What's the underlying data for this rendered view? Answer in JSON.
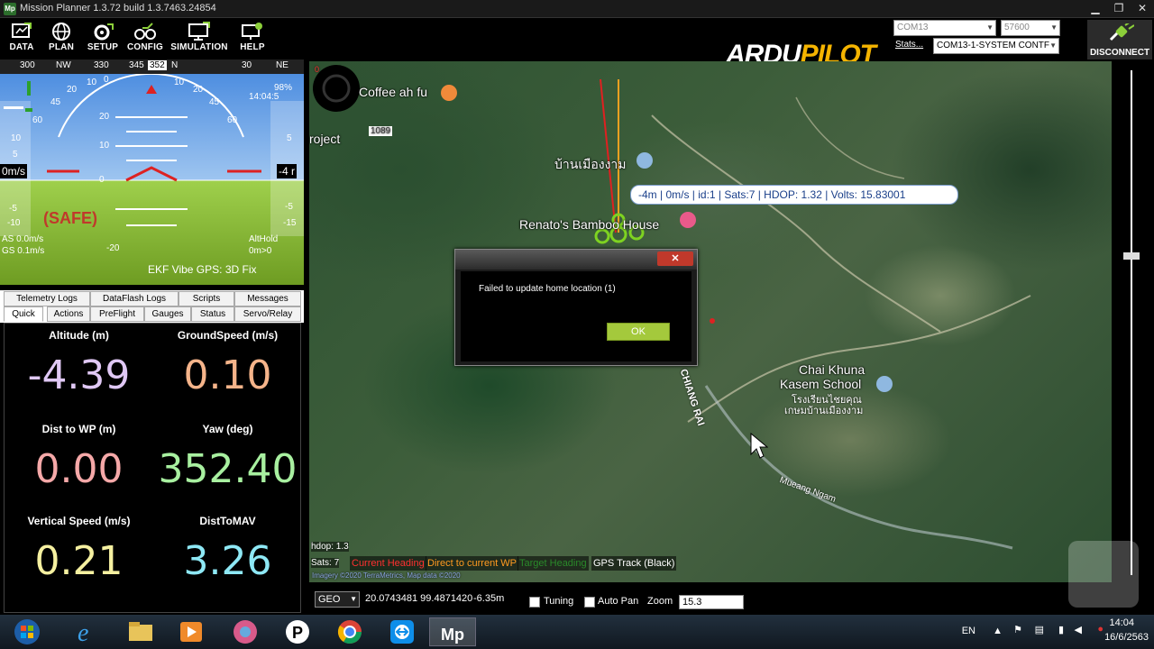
{
  "window": {
    "title": "Mission Planner 1.3.72 build 1.3.7463.24854",
    "app_icon_text": "Mp",
    "minimize": "▁",
    "maximize": "❐",
    "close": "✕"
  },
  "menu": [
    {
      "label": "DATA",
      "icon": "data-icon"
    },
    {
      "label": "PLAN",
      "icon": "plan-globe-icon"
    },
    {
      "label": "SETUP",
      "icon": "setup-icon"
    },
    {
      "label": "CONFIG",
      "icon": "config-icon"
    },
    {
      "label": "SIMULATION",
      "icon": "simulation-icon"
    },
    {
      "label": "HELP",
      "icon": "help-icon"
    }
  ],
  "header": {
    "logo_white": "ARDU",
    "logo_gold": "PILOT",
    "port": "COM13",
    "baud": "57600",
    "stats_link": "Stats...",
    "link_id": "COM13-1-SYSTEM CONTF",
    "disconnect_label": "DISCONNECT"
  },
  "hud": {
    "compass": [
      "300",
      "NW",
      "330",
      "345",
      "352",
      "N",
      "30",
      "NE"
    ],
    "pitch_marks_up": [
      "20",
      "10",
      "10"
    ],
    "pitch_zero": "0",
    "pitch_marks_down": [
      "-20"
    ],
    "roll_scale": [
      "30",
      "20",
      "10",
      "0",
      "10",
      "20",
      "30",
      "45",
      "60",
      "60",
      "45"
    ],
    "left_speed_ticks": [
      "10",
      "5",
      "-5",
      "-10"
    ],
    "right_alt_ticks": [
      "5",
      "-5",
      "-10",
      "-15"
    ],
    "speed_readout": "0m/s",
    "alt_readout": "-4 r",
    "battery": "98%",
    "time": "14:04:5",
    "safe_text": "(SAFE)",
    "airspeed": "AS 0.0m/s",
    "groundspeed": "GS 0.1m/s",
    "mode": "AltHold",
    "mode_wp": "0m>0",
    "status_line": "EKF  Vibe  GPS: 3D Fix"
  },
  "tabs_row1": [
    "Telemetry Logs",
    "DataFlash Logs",
    "Scripts",
    "Messages"
  ],
  "tabs_row2": [
    "Quick",
    "Actions",
    "PreFlight",
    "Gauges",
    "Status",
    "Servo/Relay"
  ],
  "active_tab": "Quick",
  "quick": [
    {
      "label": "Altitude (m)",
      "value": "-4.39",
      "color": "#e0c8f5"
    },
    {
      "label": "GroundSpeed (m/s)",
      "value": "0.10",
      "color": "#f5b48a"
    },
    {
      "label": "Dist to WP (m)",
      "value": "0.00",
      "color": "#f5a8a8"
    },
    {
      "label": "Yaw (deg)",
      "value": "352.40",
      "color": "#a8f0a0"
    },
    {
      "label": "Vertical Speed (m/s)",
      "value": "0.21",
      "color": "#f5f0a0"
    },
    {
      "label": "DistToMAV",
      "value": "3.26",
      "color": "#8ee8f5"
    }
  ],
  "map": {
    "places": [
      {
        "text": "Coffee ah fu"
      },
      {
        "text": "roject"
      },
      {
        "text": "บ้านเมืองงาม"
      },
      {
        "text": "Renato's Bamboo House"
      },
      {
        "text": "Chai Khuna"
      },
      {
        "text": "Kasem School"
      },
      {
        "text": "โรงเรียนไชยคุณ"
      },
      {
        "text": "เกษมบ้านเมืองงาม"
      },
      {
        "text": "CHIANG RAI"
      },
      {
        "text": "1089"
      },
      {
        "text": "Mueang Ngam"
      }
    ],
    "telemetry": "-4m | 0m/s | id:1 | Sats:7 | HDOP: 1.32 | Volts: 15.83001",
    "hdop": "hdop: 1.3",
    "sats": "Sats: 7",
    "legend": [
      {
        "text": "Current Heading",
        "color": "#ff3030"
      },
      {
        "text": "Direct to current WP",
        "color": "#ff9a20"
      },
      {
        "text": "Target Heading",
        "color": "#2a8a2a"
      },
      {
        "text": "GPS Track (Black)",
        "color": "#ffffff"
      }
    ],
    "scale_text": "Imagery ©2020 TerraMetrics, Map data ©2020",
    "corner_flag": "0"
  },
  "dialog": {
    "message": "Failed to update home location (1)",
    "ok": "OK",
    "close": "✕"
  },
  "map_bottom": {
    "mode": "GEO",
    "coords": "20.0743481 99.4871420",
    "alt": "-6.35m",
    "tuning": "Tuning",
    "autopan": "Auto Pan",
    "zoom_label": "Zoom",
    "zoom_value": "15.3"
  },
  "taskbar": {
    "apps": [
      "start-orb-icon",
      "ie-icon",
      "explorer-icon",
      "media-icon",
      "app-swirl-icon",
      "p-app-icon",
      "chrome-icon",
      "teamviewer-icon",
      "mission-planner-icon"
    ],
    "lang": "EN",
    "time": "14:04",
    "date": "16/6/2563"
  }
}
